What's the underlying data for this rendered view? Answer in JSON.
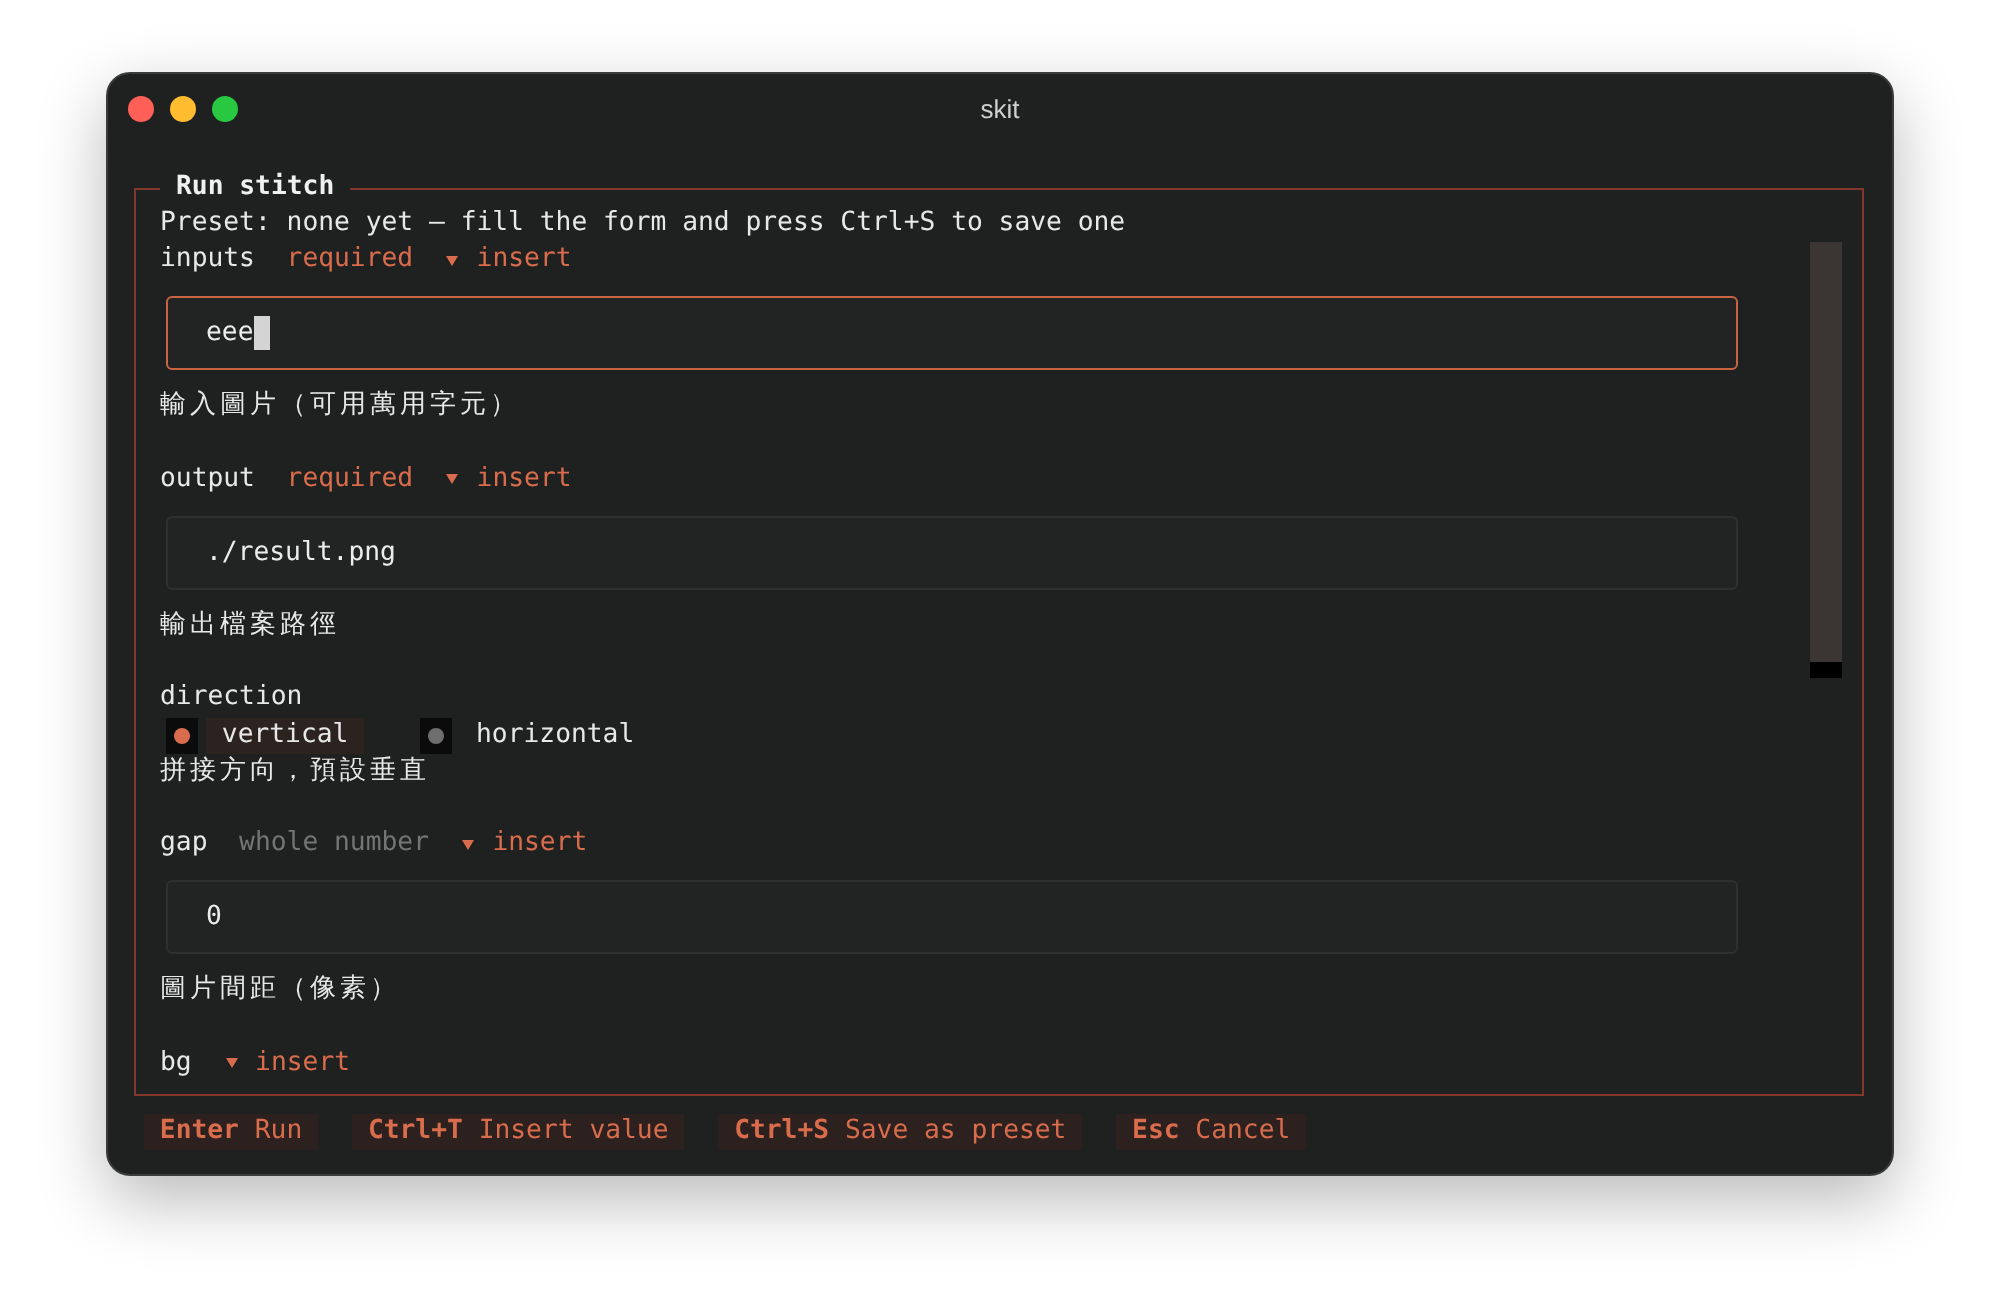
{
  "window": {
    "title": "skit"
  },
  "panel": {
    "title": "Run stitch",
    "preset_note": "Preset: none yet — fill the form and press Ctrl+S to save one"
  },
  "fields": [
    {
      "kind": "text",
      "label": "inputs",
      "tag": {
        "text": "required",
        "kind": "required"
      },
      "action": "insert",
      "value": "eee",
      "focused": true,
      "description": "輸入圖片（可用萬用字元）"
    },
    {
      "kind": "text",
      "label": "output",
      "tag": {
        "text": "required",
        "kind": "required"
      },
      "action": "insert",
      "value": "./result.png",
      "focused": false,
      "description": "輸出檔案路徑"
    },
    {
      "kind": "choice",
      "label": "direction",
      "options": [
        {
          "label": "vertical",
          "selected": true
        },
        {
          "label": "horizontal",
          "selected": false
        }
      ],
      "description": "拼接方向，預設垂直"
    },
    {
      "kind": "text",
      "label": "gap",
      "tag": {
        "text": "whole number",
        "kind": "hint"
      },
      "action": "insert",
      "value": "0",
      "focused": false,
      "description": "圖片間距（像素）"
    },
    {
      "kind": "text",
      "label": "bg",
      "action": "insert"
    }
  ],
  "footer": {
    "shortcuts": [
      {
        "key": "Enter",
        "label": "Run"
      },
      {
        "key": "Ctrl+T",
        "label": "Insert value"
      },
      {
        "key": "Ctrl+S",
        "label": "Save as preset"
      },
      {
        "key": "Esc",
        "label": "Cancel"
      }
    ]
  }
}
